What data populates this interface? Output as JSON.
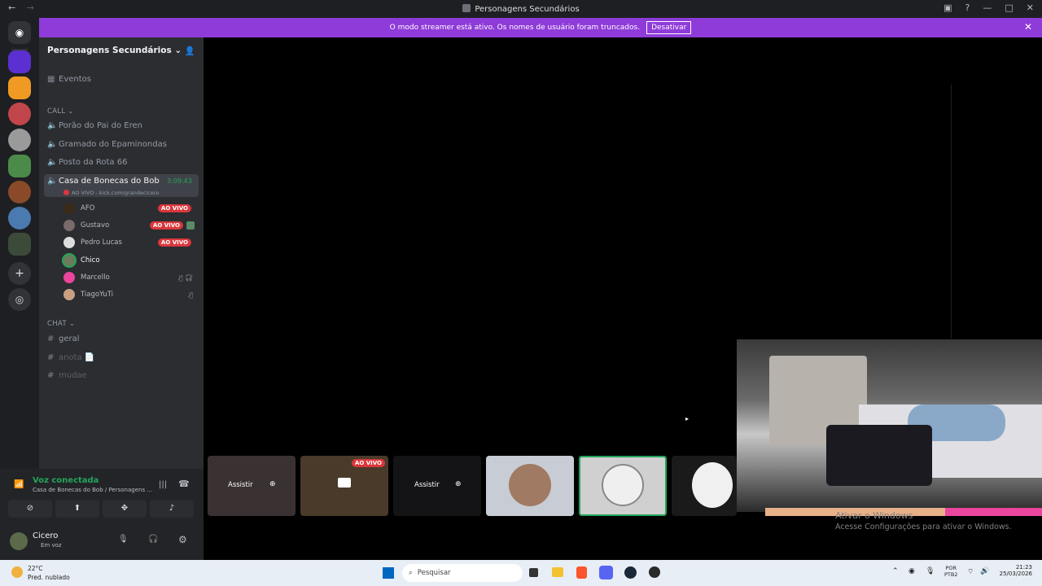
{
  "window": {
    "title": "Personagens Secundários"
  },
  "banner": {
    "text": "O modo streamer está ativo. Os nomes de usuário foram truncados.",
    "button": "Desativar"
  },
  "guild": {
    "name": "Personagens Secundários"
  },
  "events_label": "Eventos",
  "categories": {
    "call": "CALL",
    "chat": "CHAT"
  },
  "voice_channels": [
    {
      "name": "Porão do Pai do Eren"
    },
    {
      "name": "Gramado do Epaminondas"
    },
    {
      "name": "Posto da Rota 66"
    },
    {
      "name": "Casa de Bonecas do Bob",
      "timer": "3:09:43",
      "status": "AO VIVO - kick.com/grandecicero"
    }
  ],
  "voice_users": [
    {
      "name": "AFO",
      "live": "AO VIVO"
    },
    {
      "name": "Gustavo",
      "live": "AO VIVO"
    },
    {
      "name": "Pedro Lucas",
      "live": "AO VIVO"
    },
    {
      "name": "Chico"
    },
    {
      "name": "Marcello"
    },
    {
      "name": "TiagoYuTi"
    }
  ],
  "text_channels": [
    {
      "name": "geral"
    },
    {
      "name": "anota"
    },
    {
      "name": "mudae"
    }
  ],
  "voice_panel": {
    "status": "Voz conectada",
    "channel": "Casa de Bonecas do Bob / Personagens ..."
  },
  "user": {
    "name": "Cicero",
    "status": "Em voz"
  },
  "stream_tiles": {
    "watch": "Assistir",
    "live": "AO VIVO"
  },
  "activation": {
    "title": "Ativar o Windows",
    "subtitle": "Acesse Configurações para ativar o Windows."
  },
  "taskbar": {
    "weather_temp": "22°C",
    "weather_desc": "Pred. nublado",
    "search": "Pesquisar",
    "lang1": "POR",
    "lang2": "PTB2",
    "time": "21:23",
    "date": "25/03/2026"
  },
  "colors": {
    "banner": "#8f3bd9",
    "live": "#da373c",
    "green": "#23a55a"
  }
}
